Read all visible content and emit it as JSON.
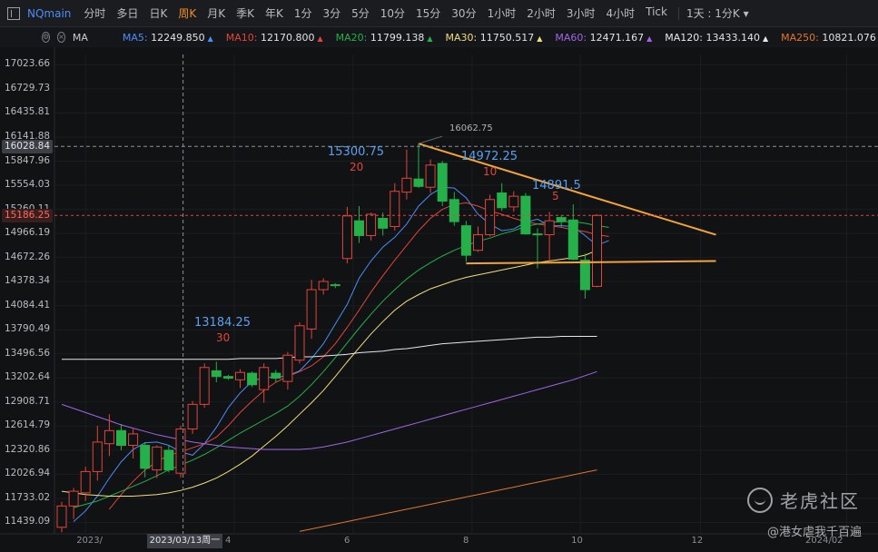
{
  "toolbar": {
    "symbol": "NQmain",
    "timeframes": [
      "分时",
      "多日",
      "日K",
      "周K",
      "月K",
      "季K",
      "年K",
      "1分",
      "3分",
      "5分",
      "10分",
      "15分",
      "30分",
      "1小时",
      "2小时",
      "3小时",
      "4小时",
      "Tick"
    ],
    "active_timeframe": "周K",
    "interval_dropdown": "1天 : 1分K"
  },
  "indicators": {
    "label": "MA",
    "items": [
      {
        "name": "MA5",
        "value": "12249.850",
        "color": "#4c8df6"
      },
      {
        "name": "MA10",
        "value": "12170.800",
        "color": "#e2453b"
      },
      {
        "name": "MA20",
        "value": "11799.138",
        "color": "#25b04a"
      },
      {
        "name": "MA30",
        "value": "11750.517",
        "color": "#f2de7a"
      },
      {
        "name": "MA60",
        "value": "12471.167",
        "color": "#a066e8"
      },
      {
        "name": "MA120",
        "value": "13433.140",
        "color": "#e8e8e8"
      },
      {
        "name": "MA250",
        "value": "10821.076",
        "color": "#e0762a"
      }
    ]
  },
  "price_axis": {
    "ticks": [
      "17023.66",
      "16729.73",
      "16435.81",
      "16141.88",
      "15847.96",
      "15554.03",
      "15260.11",
      "14966.19",
      "14672.26",
      "14378.34",
      "14084.41",
      "13790.49",
      "13496.56",
      "13202.64",
      "12908.71",
      "12614.79",
      "12320.86",
      "12026.94",
      "11733.02",
      "11439.09"
    ],
    "crosshair_price": "16028.84",
    "last_price": "15186.25"
  },
  "time_axis": {
    "labels": [
      "2023/",
      "4",
      "6",
      "8",
      "10",
      "12",
      "2024/02"
    ],
    "crosshair_date": "2023/03/13周一"
  },
  "annotations": [
    {
      "price": "13184.25",
      "count": "30"
    },
    {
      "price": "15300.75",
      "count": "20"
    },
    {
      "price": "14972.25",
      "count": "10"
    },
    {
      "price": "14891.5",
      "count": "5"
    },
    {
      "high": "16062.75"
    }
  ],
  "watermark": {
    "brand": "老虎社区",
    "author": "@港女虐我千百遍"
  },
  "colors": {
    "up": "#e2453b",
    "down": "#25b04a",
    "trendline": "#f2a33a",
    "crosshair": "#8c9097",
    "last_price_line": "#e2453b"
  },
  "chart_data": {
    "type": "candlestick",
    "period": "weekly",
    "x_range": [
      "2023-01",
      "2024-02"
    ],
    "ylim": [
      11300,
      17150
    ],
    "candles": [
      {
        "o": 11380,
        "h": 11690,
        "l": 11320,
        "c": 11640
      },
      {
        "o": 11640,
        "h": 11860,
        "l": 11480,
        "c": 11820
      },
      {
        "o": 11800,
        "h": 12120,
        "l": 11700,
        "c": 12060
      },
      {
        "o": 12060,
        "h": 12620,
        "l": 11950,
        "c": 12420
      },
      {
        "o": 12400,
        "h": 12760,
        "l": 12250,
        "c": 12560
      },
      {
        "o": 12560,
        "h": 12640,
        "l": 12320,
        "c": 12380
      },
      {
        "o": 12380,
        "h": 12580,
        "l": 12220,
        "c": 12520
      },
      {
        "o": 12380,
        "h": 12420,
        "l": 11990,
        "c": 12100
      },
      {
        "o": 12080,
        "h": 12380,
        "l": 11980,
        "c": 12360
      },
      {
        "o": 12320,
        "h": 12380,
        "l": 12050,
        "c": 12080
      },
      {
        "o": 12040,
        "h": 12620,
        "l": 11990,
        "c": 12580
      },
      {
        "o": 12580,
        "h": 12920,
        "l": 12520,
        "c": 12880
      },
      {
        "o": 12880,
        "h": 13380,
        "l": 12840,
        "c": 13330
      },
      {
        "o": 13290,
        "h": 13400,
        "l": 13150,
        "c": 13220
      },
      {
        "o": 13220,
        "h": 13240,
        "l": 13180,
        "c": 13200
      },
      {
        "o": 13180,
        "h": 13310,
        "l": 13080,
        "c": 13270
      },
      {
        "o": 13260,
        "h": 13280,
        "l": 13090,
        "c": 13120
      },
      {
        "o": 13060,
        "h": 13380,
        "l": 12900,
        "c": 13330
      },
      {
        "o": 13260,
        "h": 13300,
        "l": 13150,
        "c": 13200
      },
      {
        "o": 13160,
        "h": 13520,
        "l": 13060,
        "c": 13480
      },
      {
        "o": 13420,
        "h": 13880,
        "l": 13380,
        "c": 13840
      },
      {
        "o": 13800,
        "h": 14400,
        "l": 13680,
        "c": 14280
      },
      {
        "o": 14280,
        "h": 14420,
        "l": 14220,
        "c": 14380
      },
      {
        "o": 14340,
        "h": 14360,
        "l": 14300,
        "c": 14330
      },
      {
        "o": 14660,
        "h": 15290,
        "l": 14600,
        "c": 15180
      },
      {
        "o": 15120,
        "h": 15300,
        "l": 14850,
        "c": 14940
      },
      {
        "o": 14940,
        "h": 15220,
        "l": 14880,
        "c": 15200
      },
      {
        "o": 15150,
        "h": 15220,
        "l": 14940,
        "c": 15030
      },
      {
        "o": 15050,
        "h": 15580,
        "l": 15000,
        "c": 15480
      },
      {
        "o": 15470,
        "h": 15990,
        "l": 15380,
        "c": 15640
      },
      {
        "o": 15630,
        "h": 16062,
        "l": 15520,
        "c": 15540
      },
      {
        "o": 15530,
        "h": 15870,
        "l": 15460,
        "c": 15800
      },
      {
        "o": 15820,
        "h": 15850,
        "l": 15300,
        "c": 15360
      },
      {
        "o": 15380,
        "h": 15470,
        "l": 15060,
        "c": 15110
      },
      {
        "o": 15060,
        "h": 15120,
        "l": 14620,
        "c": 14700
      },
      {
        "o": 14760,
        "h": 15050,
        "l": 14740,
        "c": 14950
      },
      {
        "o": 14950,
        "h": 15440,
        "l": 14930,
        "c": 15380
      },
      {
        "o": 15460,
        "h": 15580,
        "l": 15240,
        "c": 15280
      },
      {
        "o": 15290,
        "h": 15480,
        "l": 15230,
        "c": 15420
      },
      {
        "o": 15420,
        "h": 15460,
        "l": 14950,
        "c": 14960
      },
      {
        "o": 14960,
        "h": 15030,
        "l": 14540,
        "c": 14950
      },
      {
        "o": 14950,
        "h": 15230,
        "l": 14600,
        "c": 15120
      },
      {
        "o": 15160,
        "h": 15190,
        "l": 15040,
        "c": 15110
      },
      {
        "o": 15130,
        "h": 15320,
        "l": 14640,
        "c": 14650
      },
      {
        "o": 14640,
        "h": 14720,
        "l": 14170,
        "c": 14280
      },
      {
        "o": 14320,
        "h": 15200,
        "l": 14310,
        "c": 15186
      }
    ],
    "ma_series": [
      {
        "name": "MA5",
        "start": 1,
        "values": [
          11450,
          11580,
          11760,
          11980,
          12180,
          12330,
          12410,
          12420,
          12380,
          12300,
          12260,
          12400,
          12600,
          12840,
          13020,
          13160,
          13210,
          13210,
          13230,
          13290,
          13440,
          13620,
          13860,
          14100,
          14420,
          14630,
          14800,
          14920,
          15080,
          15300,
          15440,
          15530,
          15520,
          15400,
          15200,
          15080,
          15000,
          15020,
          15100,
          15140,
          15060,
          15060,
          15050,
          14940,
          14820,
          14880
        ]
      },
      {
        "name": "MA10",
        "start": 4,
        "values": [
          11600,
          11780,
          11940,
          12080,
          12180,
          12260,
          12300,
          12350,
          12400,
          12480,
          12620,
          12780,
          12920,
          13050,
          13150,
          13220,
          13280,
          13350,
          13460,
          13620,
          13820,
          14030,
          14250,
          14450,
          14640,
          14820,
          15000,
          15150,
          15260,
          15320,
          15340,
          15300,
          15240,
          15200,
          15150,
          15110,
          15080,
          15060,
          15040,
          15010,
          14990,
          14950,
          14930
        ]
      },
      {
        "name": "MA20",
        "start": 1,
        "values": [
          11620,
          11660,
          11700,
          11760,
          11820,
          11880,
          11940,
          12010,
          12080,
          12140,
          12200,
          12270,
          12350,
          12440,
          12530,
          12610,
          12690,
          12770,
          12860,
          12980,
          13120,
          13280,
          13450,
          13630,
          13810,
          13980,
          14140,
          14280,
          14410,
          14520,
          14610,
          14690,
          14760,
          14820,
          14870,
          14910,
          14960,
          15000,
          15050,
          15080,
          15100,
          15110,
          15110,
          15090,
          15060,
          15040
        ]
      },
      {
        "name": "MA30",
        "start": 0,
        "values": [
          11820,
          11800,
          11780,
          11770,
          11760,
          11760,
          11760,
          11770,
          11780,
          11800,
          11830,
          11870,
          11920,
          11980,
          12060,
          12150,
          12250,
          12370,
          12490,
          12620,
          12760,
          12900,
          13050,
          13220,
          13400,
          13570,
          13740,
          13890,
          14030,
          14140,
          14220,
          14290,
          14340,
          14390,
          14430,
          14460,
          14490,
          14520,
          14550,
          14580,
          14610,
          14630,
          14650,
          14670,
          14700,
          14760
        ]
      },
      {
        "name": "MA60",
        "start": 0,
        "values": [
          12880,
          12830,
          12780,
          12730,
          12680,
          12630,
          12590,
          12550,
          12510,
          12480,
          12450,
          12420,
          12400,
          12380,
          12360,
          12350,
          12340,
          12330,
          12330,
          12330,
          12330,
          12340,
          12360,
          12390,
          12420,
          12460,
          12500,
          12540,
          12580,
          12620,
          12660,
          12700,
          12740,
          12780,
          12820,
          12860,
          12900,
          12940,
          12980,
          13020,
          13060,
          13100,
          13140,
          13180,
          13230,
          13280
        ]
      },
      {
        "name": "MA120",
        "start": 0,
        "values": [
          13430,
          13430,
          13430,
          13430,
          13430,
          13430,
          13430,
          13430,
          13430,
          13430,
          13430,
          13430,
          13430,
          13430,
          13430,
          13440,
          13440,
          13440,
          13440,
          13450,
          13460,
          13460,
          13470,
          13480,
          13490,
          13510,
          13520,
          13530,
          13550,
          13560,
          13580,
          13600,
          13620,
          13630,
          13640,
          13650,
          13660,
          13670,
          13680,
          13690,
          13700,
          13700,
          13710,
          13710,
          13710,
          13710
        ]
      },
      {
        "name": "MA250",
        "start": 20,
        "values": [
          11330,
          11360,
          11390,
          11420,
          11450,
          11480,
          11510,
          11540,
          11570,
          11600,
          11630,
          11660,
          11690,
          11720,
          11750,
          11780,
          11810,
          11840,
          11870,
          11900,
          11930,
          11960,
          11990,
          12020,
          12050,
          12080
        ]
      }
    ],
    "trendlines": [
      {
        "from": {
          "i": 30,
          "p": 16062
        },
        "to": {
          "i": 55,
          "p": 14950
        }
      },
      {
        "from": {
          "i": 34,
          "p": 14600
        },
        "to": {
          "i": 55,
          "p": 14630
        }
      }
    ]
  }
}
